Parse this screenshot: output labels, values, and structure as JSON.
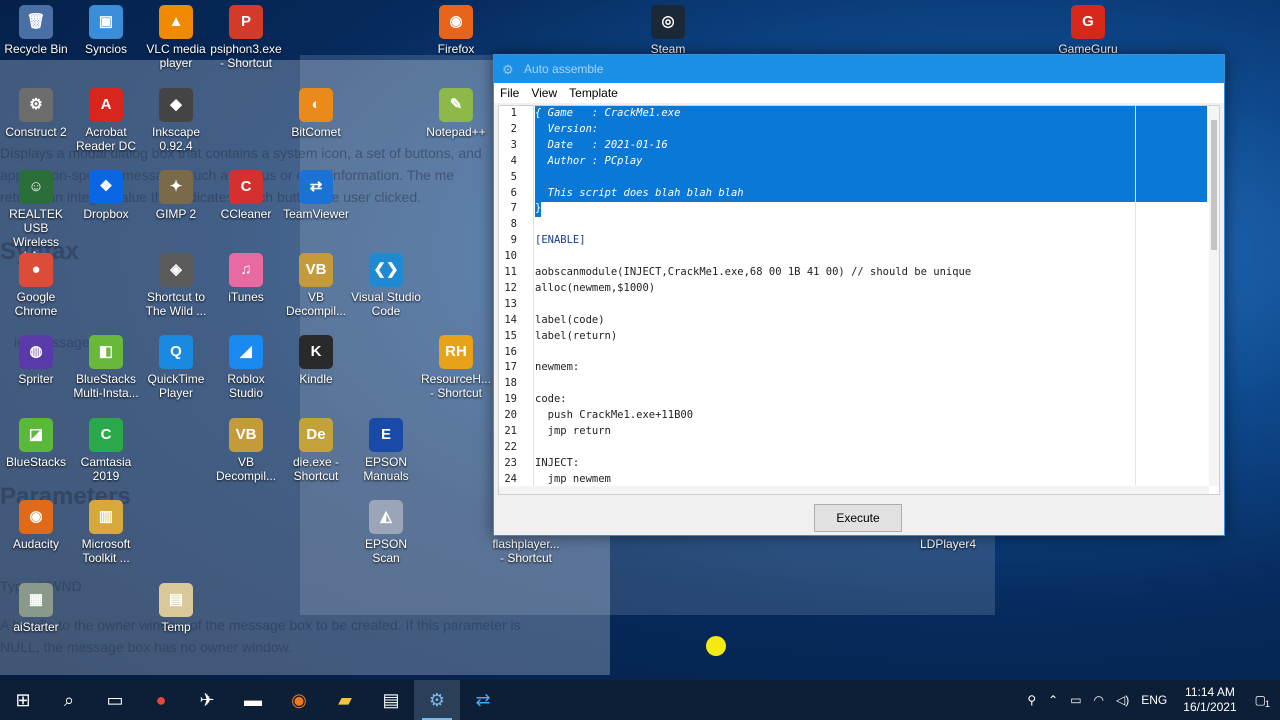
{
  "background_ghost": {
    "lines": [
      "Displays a modal dialog box that contains a system icon, a set of buttons, and",
      "application-specific message, such as status or error information. The me",
      "returns an integer value that indicates which button the user clicked.",
      "int MessageBox(",
      "Type: HWND",
      "A handle to the owner window of the message box to be created. If this parameter is",
      "NULL, the message box has no owner window."
    ],
    "headings": [
      "Syntax",
      "Parameters"
    ]
  },
  "desktop_icons": [
    {
      "label": "Recycle Bin",
      "glyph": "🗑",
      "color": "#4a6fa5"
    },
    {
      "label": "Syncios",
      "glyph": "▣",
      "color": "#3a8ed8"
    },
    {
      "label": "VLC media player",
      "glyph": "▲",
      "color": "#f08a00"
    },
    {
      "label": "psiphon3.exe - Shortcut",
      "glyph": "P",
      "color": "#d43a2a"
    },
    {
      "label": "Firefox",
      "glyph": "◉",
      "color": "#e8641a"
    },
    {
      "label": "Steam",
      "glyph": "◎",
      "color": "#1b2838"
    },
    {
      "label": "GameGuru",
      "glyph": "G",
      "color": "#d8281c"
    },
    {
      "label": "Construct 2",
      "glyph": "⚙",
      "color": "#6d6d6d"
    },
    {
      "label": "Acrobat Reader DC",
      "glyph": "A",
      "color": "#d8261c"
    },
    {
      "label": "Inkscape 0.92.4",
      "glyph": "◆",
      "color": "#444"
    },
    {
      "label": "BitComet",
      "glyph": "◐",
      "color": "#e98a1a"
    },
    {
      "label": "Notepad++",
      "glyph": "✎",
      "color": "#8db84a"
    },
    {
      "label": "REALTEK USB Wireless LA...",
      "glyph": "☺",
      "color": "#2b6e3a"
    },
    {
      "label": "Dropbox",
      "glyph": "❖",
      "color": "#0a66e4"
    },
    {
      "label": "GIMP 2",
      "glyph": "✦",
      "color": "#7a6a4a"
    },
    {
      "label": "CCleaner",
      "glyph": "C",
      "color": "#d43030"
    },
    {
      "label": "TeamViewer",
      "glyph": "⇄",
      "color": "#1a73d4"
    },
    {
      "label": "Google Chrome",
      "glyph": "●",
      "color": "#dd4b39"
    },
    {
      "label": "Shortcut to The Wild ...",
      "glyph": "◈",
      "color": "#5a5a5a"
    },
    {
      "label": "iTunes",
      "glyph": "♫",
      "color": "#e86aa0"
    },
    {
      "label": "VB Decompil...",
      "glyph": "VB",
      "color": "#c49a3a"
    },
    {
      "label": "Visual Studio Code",
      "glyph": "❮❯",
      "color": "#1f8ad2"
    },
    {
      "label": "Spriter",
      "glyph": "◍",
      "color": "#5a3aa8"
    },
    {
      "label": "BlueStacks Multi-Insta...",
      "glyph": "◧",
      "color": "#6ab83a"
    },
    {
      "label": "QuickTime Player",
      "glyph": "Q",
      "color": "#1a8ae0"
    },
    {
      "label": "Roblox Studio",
      "glyph": "◢",
      "color": "#1a8af0"
    },
    {
      "label": "Kindle",
      "glyph": "K",
      "color": "#2a2a2a"
    },
    {
      "label": "ResourceH... - Shortcut",
      "glyph": "RH",
      "color": "#e8a21a"
    },
    {
      "label": "BlueStacks",
      "glyph": "◪",
      "color": "#5ab83a"
    },
    {
      "label": "Camtasia 2019",
      "glyph": "C",
      "color": "#2aa84a"
    },
    {
      "label": "VB Decompil...",
      "glyph": "VB",
      "color": "#c49a3a"
    },
    {
      "label": "die.exe - Shortcut",
      "glyph": "De",
      "color": "#c4a23a"
    },
    {
      "label": "EPSON Manuals",
      "glyph": "E",
      "color": "#1a4aa8"
    },
    {
      "label": "Audacity",
      "glyph": "◉",
      "color": "#e06a1a"
    },
    {
      "label": "Microsoft Toolkit ...",
      "glyph": "▥",
      "color": "#d8a83a"
    },
    {
      "label": "EPSON Scan",
      "glyph": "◭",
      "color": "#9aa6b8"
    },
    {
      "label": "flashplayer... - Shortcut",
      "glyph": "",
      "color": "transparent"
    },
    {
      "label": "LDPlayer4",
      "glyph": "",
      "color": "transparent"
    },
    {
      "label": "aiStarter",
      "glyph": "▦",
      "color": "#8a9a8a"
    },
    {
      "label": "Temp",
      "glyph": "▤",
      "color": "#d8c89a"
    }
  ],
  "window": {
    "title": "Auto assemble",
    "menu": [
      "File",
      "View",
      "Template"
    ],
    "execute_label": "Execute",
    "lines": [
      {
        "n": "1",
        "t": "{ Game   : CrackMe1.exe",
        "c": "sel"
      },
      {
        "n": "2",
        "t": "  Version:",
        "c": "sel"
      },
      {
        "n": "3",
        "t": "  Date   : 2021-01-16",
        "c": "sel"
      },
      {
        "n": "4",
        "t": "  Author : PCplay",
        "c": "sel"
      },
      {
        "n": "5",
        "t": "",
        "c": "sel"
      },
      {
        "n": "6",
        "t": "  This script does blah blah blah",
        "c": "sel"
      },
      {
        "n": "7",
        "t": "}",
        "c": "plain"
      },
      {
        "n": "8",
        "t": "",
        "c": "plain"
      },
      {
        "n": "9",
        "t": "[ENABLE]",
        "c": "plain"
      },
      {
        "n": "10",
        "t": "",
        "c": "plain"
      },
      {
        "n": "11",
        "t": "aobscanmodule(INJECT,CrackMe1.exe,68 00 1B 41 00) // should be unique",
        "c": "plain"
      },
      {
        "n": "12",
        "t": "alloc(newmem,$1000)",
        "c": "plain"
      },
      {
        "n": "13",
        "t": "",
        "c": "plain"
      },
      {
        "n": "14",
        "t": "label(code)",
        "c": "plain"
      },
      {
        "n": "15",
        "t": "label(return)",
        "c": "plain"
      },
      {
        "n": "16",
        "t": "",
        "c": "plain"
      },
      {
        "n": "17",
        "t": "newmem:",
        "c": "plain"
      },
      {
        "n": "18",
        "t": "",
        "c": "plain"
      },
      {
        "n": "19",
        "t": "code:",
        "c": "plain"
      },
      {
        "n": "20",
        "t": "  push CrackMe1.exe+11B00",
        "c": "plain"
      },
      {
        "n": "21",
        "t": "  jmp return",
        "c": "plain"
      },
      {
        "n": "22",
        "t": "",
        "c": "plain"
      },
      {
        "n": "23",
        "t": "INJECT:",
        "c": "plain"
      },
      {
        "n": "24",
        "t": "  jmp newmem",
        "c": "plain"
      }
    ]
  },
  "taskbar": {
    "items": [
      "windows-start",
      "search",
      "task-view",
      "chrome",
      "app-bird",
      "terminal",
      "firefox",
      "file-explorer",
      "notepad",
      "cheat-engine",
      "teamviewer"
    ],
    "tray_lang": "ENG",
    "time": "11:14 AM",
    "date": "16/1/2021",
    "notif_count": "1"
  }
}
